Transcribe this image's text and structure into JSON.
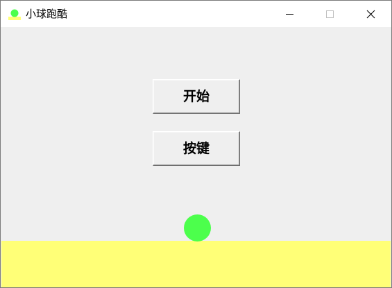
{
  "window": {
    "title": "小球跑酷",
    "icon": "ball-app-icon",
    "controls": {
      "minimize_icon": "minimize-icon",
      "maximize_icon": "maximize-icon",
      "close_icon": "close-icon"
    }
  },
  "buttons": {
    "start_label": "开始",
    "keys_label": "按键"
  },
  "game": {
    "ball_color": "#4cff4c",
    "ground_color": "#ffff77",
    "background_color": "#efefef"
  }
}
